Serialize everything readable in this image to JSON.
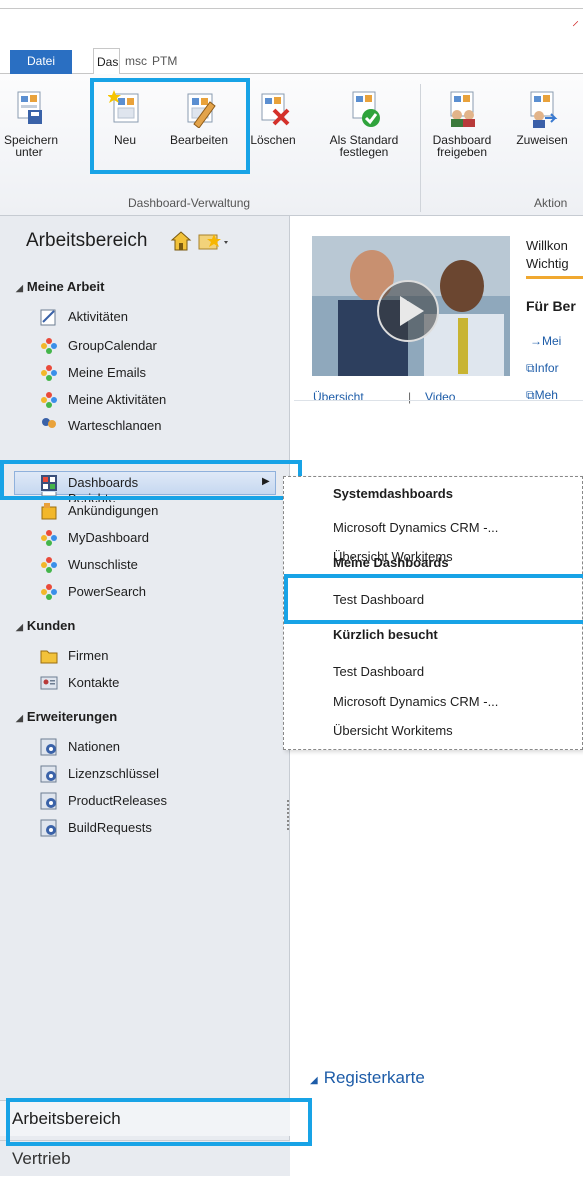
{
  "ribbon": {
    "tabs": {
      "file": "Datei",
      "dashboard": "Das",
      "msc": "msc",
      "ptm": "PTM"
    },
    "buttons": {
      "save_as_line1": "Speichern",
      "save_as_line2": "unter",
      "new": "Neu",
      "edit": "Bearbeiten",
      "delete": "Löschen",
      "set_default_line1": "Als Standard",
      "set_default_line2": "festlegen",
      "share_line1": "Dashboard",
      "share_line2": "freigeben",
      "assign": "Zuweisen"
    },
    "groups": {
      "dashboard_management": "Dashboard-Verwaltung",
      "action": "Aktion"
    }
  },
  "leftnav": {
    "title": "Arbeitsbereich",
    "sections": [
      {
        "label": "Meine Arbeit",
        "items": [
          "Aktivitäten",
          "GroupCalendar",
          "Meine Emails",
          "Meine Aktivitäten",
          "Warteschlangen",
          "Dashboards",
          "Berichte",
          "Ankündigungen",
          "MyDashboard",
          "Wunschliste",
          "PowerSearch"
        ]
      },
      {
        "label": "Kunden",
        "items": [
          "Firmen",
          "Kontakte"
        ]
      },
      {
        "label": "Erweiterungen",
        "items": [
          "Nationen",
          "Lizenzschlüssel",
          "ProductReleases",
          "BuildRequests"
        ]
      }
    ],
    "bottom": {
      "workspace": "Arbeitsbereich",
      "sales": "Vertrieb"
    }
  },
  "main": {
    "welcome_line1": "Willkon",
    "welcome_line2": "Wichtig",
    "for_heading": "Für Ber",
    "links": {
      "overview": "Übersicht",
      "separator": "|",
      "video": "Video",
      "meine": "Mei",
      "info": "Infor",
      "mehr": "Meh"
    },
    "register_tab": "Registerkarte"
  },
  "flyout": {
    "system_heading": "Systemdashboards",
    "system_items": [
      "Microsoft Dynamics CRM -...",
      "Übersicht Workitems"
    ],
    "my_heading": "Meine Dashboards",
    "my_items": [
      "Test Dashboard"
    ],
    "recent_heading": "Kürzlich besucht",
    "recent_items": [
      "Test Dashboard",
      "Microsoft Dynamics CRM -...",
      "Übersicht Workitems"
    ]
  },
  "colors": {
    "accent": "#2a6fc2",
    "highlight": "#18a3e6",
    "link": "#1d5ca8",
    "nav_bg": "#e8ebf0"
  }
}
